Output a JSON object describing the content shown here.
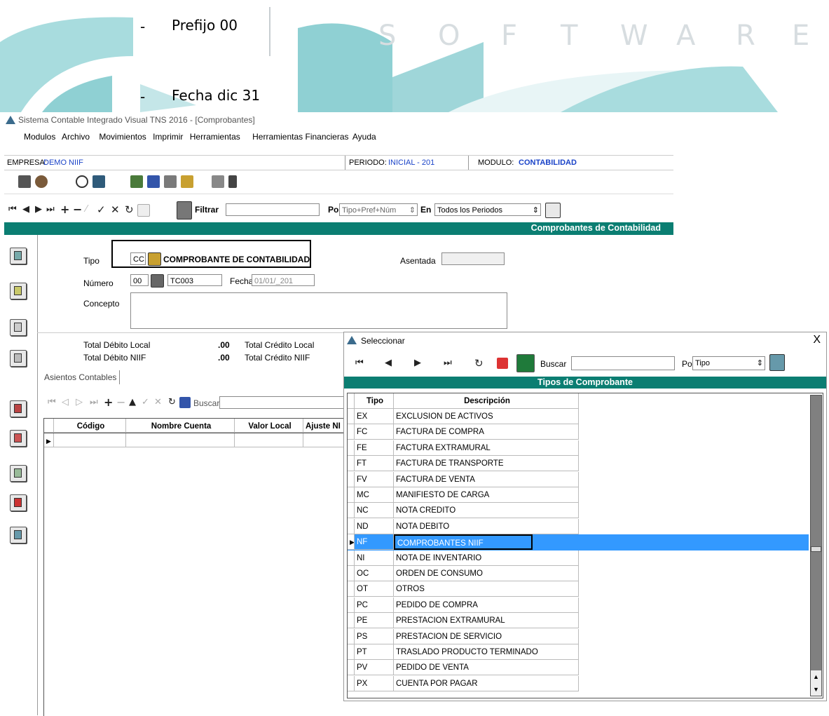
{
  "doc": {
    "bullet_dash": "-",
    "bullet1": "Prefijo 00",
    "bullet2": "Fecha dic 31",
    "brand_letters": [
      "S",
      "O",
      "F",
      "T",
      "W",
      "A",
      "R",
      "E"
    ]
  },
  "window": {
    "title": "Sistema Contable Integrado Visual TNS 2016 - [Comprobantes]"
  },
  "menu": [
    "Modulos",
    "Archivo",
    "Movimientos",
    "Imprimir",
    "Herramientas",
    "Herramientas Financieras",
    "Ayuda"
  ],
  "status": {
    "empresa_label": "EMPRESA:",
    "empresa_value": "DEMO NIIF",
    "periodo_label": "PERIODO:",
    "periodo_value": "INICIAL - 201",
    "modulo_label": "MODULO:",
    "modulo_value": "CONTABILIDAD"
  },
  "filterbar": {
    "filtrar_label": "Filtrar",
    "por_label": "Por",
    "por_value": "Tipo+Pref+Núm",
    "en_label": "En",
    "en_value": "Todos los Periodos"
  },
  "section_title": "Comprobantes de Contabilidad",
  "form": {
    "tipo_label": "Tipo",
    "tipo_code": "CC",
    "tipo_desc": "COMPROBANTE DE CONTABILIDAD",
    "asentada_label": "Asentada",
    "numero_label": "Número",
    "prefijo": "00",
    "numero": "TC003",
    "fecha_label": "Fecha",
    "fecha_value": "01/01/_201",
    "concepto_label": "Concepto",
    "tdl_label": "Total Débito Local",
    "tdl_value": ".00",
    "tcl_label": "Total Crédito Local",
    "tdn_label": "Total Débito NIIF",
    "tdn_value": ".00",
    "tcn_label": "Total Crédito NIIF"
  },
  "tabs": {
    "asientos": "Asientos Contables"
  },
  "grid": {
    "buscar_label": "Buscar",
    "columns": [
      "Código",
      "Nombre Cuenta",
      "Valor Local",
      "Ajuste NI"
    ]
  },
  "dialog": {
    "title": "Seleccionar",
    "close": "X",
    "buscar_label": "Buscar",
    "por_label": "Por",
    "por_value": "Tipo",
    "header": "Tipos de Comprobante",
    "col_tipo": "Tipo",
    "col_desc": "Descripción",
    "selected_index": 8,
    "rows": [
      {
        "tipo": "EX",
        "desc": "EXCLUSION DE ACTIVOS"
      },
      {
        "tipo": "FC",
        "desc": "FACTURA DE COMPRA"
      },
      {
        "tipo": "FE",
        "desc": "FACTURA EXTRAMURAL"
      },
      {
        "tipo": "FT",
        "desc": "FACTURA DE TRANSPORTE"
      },
      {
        "tipo": "FV",
        "desc": "FACTURA DE VENTA"
      },
      {
        "tipo": "MC",
        "desc": "MANIFIESTO DE CARGA"
      },
      {
        "tipo": "NC",
        "desc": "NOTA CREDITO"
      },
      {
        "tipo": "ND",
        "desc": "NOTA DEBITO"
      },
      {
        "tipo": "NF",
        "desc": "COMPROBANTES NIIF"
      },
      {
        "tipo": "NI",
        "desc": "NOTA DE INVENTARIO"
      },
      {
        "tipo": "OC",
        "desc": "ORDEN DE CONSUMO"
      },
      {
        "tipo": "OT",
        "desc": "OTROS"
      },
      {
        "tipo": "PC",
        "desc": "PEDIDO DE COMPRA"
      },
      {
        "tipo": "PE",
        "desc": "PRESTACION EXTRAMURAL"
      },
      {
        "tipo": "PS",
        "desc": "PRESTACION DE SERVICIO"
      },
      {
        "tipo": "PT",
        "desc": "TRASLADO PRODUCTO TERMINADO"
      },
      {
        "tipo": "PV",
        "desc": "PEDIDO DE VENTA"
      },
      {
        "tipo": "PX",
        "desc": "CUENTA POR PAGAR"
      }
    ]
  },
  "colors": {
    "teal": "#0b7e72",
    "brand_teal": "#7cc7ca",
    "selection": "#3399ff",
    "link_blue": "#1a43c8"
  }
}
